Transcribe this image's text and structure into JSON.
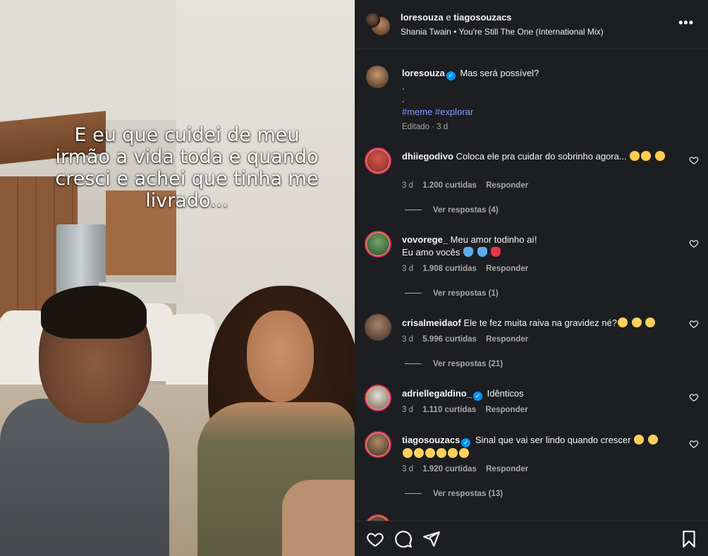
{
  "video": {
    "caption": "E eu que cuidei de meu\nirmão a vida toda e quando\ncresci e achei que tinha me\nlivrado..."
  },
  "header": {
    "user1": "loresouza",
    "conjunction": "e",
    "user2": "tiagosouzacs",
    "music_artist": "Shania Twain",
    "music_separator": "•",
    "music_title": "You're Still The One (International Mix)",
    "more_icon": "more-horizontal-icon"
  },
  "caption": {
    "username": "loresouza",
    "text": "Mas será possível?",
    "line2": ".",
    "line3": ".",
    "hashtag1": "#meme",
    "hashtag2": "#explorar",
    "edited": "Editado",
    "separator": "·",
    "time": "3 d"
  },
  "comments": [
    {
      "username": "dhiiegodivo",
      "text": "Coloca ele pra cuidar do sobrinho agora...",
      "time": "3 d",
      "likes": "1.200 curtidas",
      "reply": "Responder",
      "view_replies": "Ver respostas (4)"
    },
    {
      "username": "vovorege_",
      "text": "Meu amor todinho aí!",
      "text2": "Eu amo vocês",
      "time": "3 d",
      "likes": "1.908 curtidas",
      "reply": "Responder",
      "view_replies": "Ver respostas (1)"
    },
    {
      "username": "crisalmeidaof",
      "text": "Ele te fez muita raiva na gravidez né?",
      "time": "3 d",
      "likes": "5.996 curtidas",
      "reply": "Responder",
      "view_replies": "Ver respostas (21)"
    },
    {
      "username": "adriellegaldino_",
      "text": "Idênticos",
      "time": "3 d",
      "likes": "1.110 curtidas",
      "reply": "Responder"
    },
    {
      "username": "tiagosouzacs",
      "text": "Sinal que vai ser lindo quando crescer",
      "time": "3 d",
      "likes": "1.920 curtidas",
      "reply": "Responder",
      "view_replies": "Ver respostas (13)"
    }
  ],
  "colors": {
    "panel_bg": "#1c1e21",
    "verified": "#0095f6",
    "hashtag": "#7a9cff",
    "muted": "#a8a8a8"
  }
}
